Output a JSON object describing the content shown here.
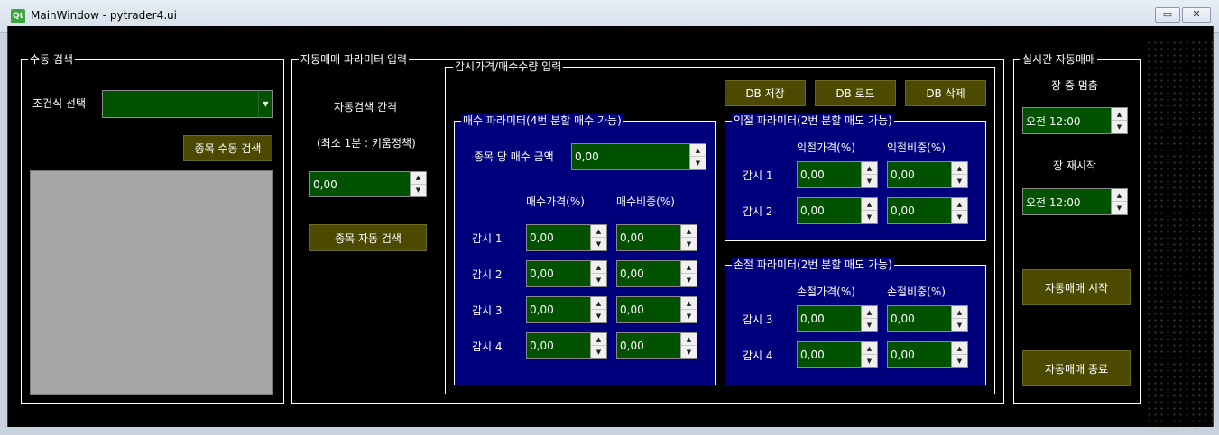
{
  "window": {
    "title": "MainWindow - pytrader4.ui",
    "logo": "Qt",
    "minimize_glyph": "▭",
    "close_glyph": "✕"
  },
  "icons": {
    "spin_up": "▲",
    "spin_down": "▼",
    "combo_arrow": "▼"
  },
  "manual": {
    "group_title": "수동 검색",
    "condition_label": "조건식 선택",
    "condition_value": "",
    "search_button": "종목 수동 검색"
  },
  "auto_params": {
    "group_title": "자동매매 파라미터 입력",
    "interval_label": "자동검색 간격",
    "interval_note": "(최소 1분 : 키움정책)",
    "interval_value": "0,00",
    "search_button": "종목 자동 검색"
  },
  "monitor": {
    "group_title": "감시가격/매수수량 입력",
    "db_save": "DB 저장",
    "db_load": "DB 로드",
    "db_delete": "DB 삭제",
    "buy": {
      "group_title": "매수 파라미터(4번 분할 매수 가능)",
      "amount_label": "종목 당 매수 금액",
      "amount_value": "0,00",
      "price_header": "매수가격(%)",
      "weight_header": "매수비중(%)",
      "rows": [
        {
          "label": "감시 1",
          "price": "0,00",
          "weight": "0,00"
        },
        {
          "label": "감시 2",
          "price": "0,00",
          "weight": "0,00"
        },
        {
          "label": "감시 3",
          "price": "0,00",
          "weight": "0,00"
        },
        {
          "label": "감시 4",
          "price": "0,00",
          "weight": "0,00"
        }
      ]
    },
    "profit": {
      "group_title": "익절 파라미터(2번 분할 매도 가능)",
      "price_header": "익절가격(%)",
      "weight_header": "익절비중(%)",
      "rows": [
        {
          "label": "감시 1",
          "price": "0,00",
          "weight": "0,00"
        },
        {
          "label": "감시 2",
          "price": "0,00",
          "weight": "0,00"
        }
      ]
    },
    "loss": {
      "group_title": "손절 파라미터(2번 분할 매도 가능)",
      "price_header": "손절가격(%)",
      "weight_header": "손절비중(%)",
      "rows": [
        {
          "label": "감시 3",
          "price": "0,00",
          "weight": "0,00"
        },
        {
          "label": "감시 4",
          "price": "0,00",
          "weight": "0,00"
        }
      ]
    }
  },
  "realtime": {
    "group_title": "실시간 자동매매",
    "pause_label": "장 중 멈춤",
    "pause_time": "오전 12:00",
    "restart_label": "장 재시작",
    "restart_time": "오전 12:00",
    "start_button": "자동매매 시작",
    "stop_button": "자동매매 종료"
  },
  "colors": {
    "background": "#000000",
    "panel_blue": "#00007c",
    "input_green": "#005200",
    "button_olive": "#4b4a00",
    "list_gray": "#a6a6a6"
  }
}
